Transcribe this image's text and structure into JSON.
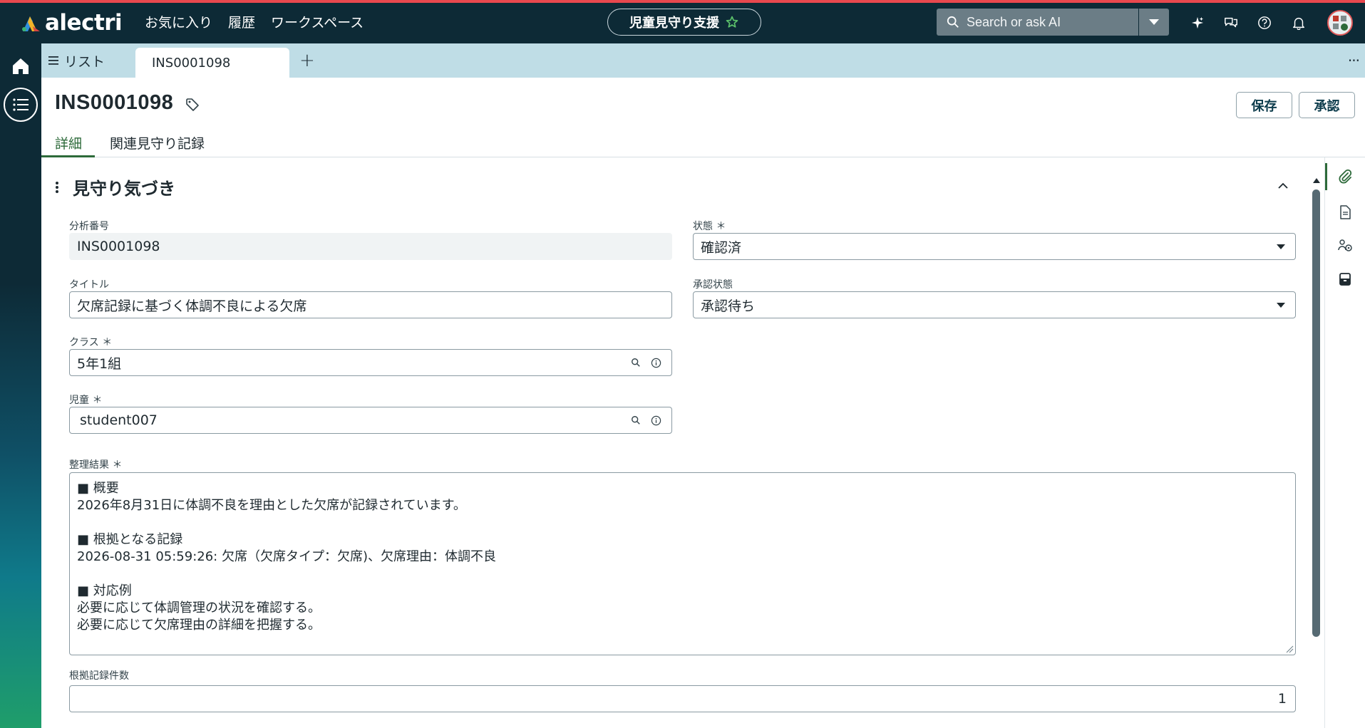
{
  "brand": {
    "name": "alectri"
  },
  "topnav": {
    "items": [
      "お気に入り",
      "履歴",
      "ワークスペース"
    ],
    "app_title": "児童見守り支援",
    "search_placeholder": "Search or ask AI"
  },
  "icons": {
    "top": [
      "sparkle-icon",
      "chat-icon",
      "help-icon",
      "bell-icon"
    ],
    "right_rail": [
      "paperclip-icon",
      "document-icon",
      "people-settings-icon",
      "archive-icon"
    ]
  },
  "tabs": {
    "list_label": "リスト",
    "active_label": "INS0001098",
    "add_label": "+",
    "more_label": "···"
  },
  "record": {
    "title": "INS0001098",
    "save_label": "保存",
    "approve_label": "承認"
  },
  "subtabs": [
    "詳細",
    "関連見守り記録"
  ],
  "section": {
    "title": "見守り気づき"
  },
  "fields": {
    "analysis_number": {
      "label": "分析番号",
      "value": "INS0001098"
    },
    "status": {
      "label": "状態",
      "value": "確認済"
    },
    "title": {
      "label": "タイトル",
      "value": "欠席記録に基づく体調不良による欠席"
    },
    "approval_status": {
      "label": "承認状態",
      "value": "承認待ち"
    },
    "class": {
      "label": "クラス",
      "value": "5年1組"
    },
    "student": {
      "label": "児童",
      "value": "student007"
    },
    "summary": {
      "label": "整理結果",
      "lines": [
        "■ 概要",
        "2026年8月31日に体調不良を理由とした欠席が記録されています。",
        "",
        "■ 根拠となる記録",
        "2026-08-31 05:59:26: 欠席（欠席タイプ：欠席)、欠席理由：体調不良",
        "",
        "■ 対応例",
        "必要に応じて体調管理の状況を確認する。",
        "必要に応じて欠席理由の詳細を把握する。"
      ]
    },
    "evidence_count": {
      "label": "根拠記録件数",
      "value": "1"
    }
  },
  "required_mark": "＊",
  "colors": {
    "topbar": "#0d2a36",
    "tabstrip": "#bfdde6",
    "accent_green": "#2d6a3a",
    "accent_red": "#e8484e"
  }
}
